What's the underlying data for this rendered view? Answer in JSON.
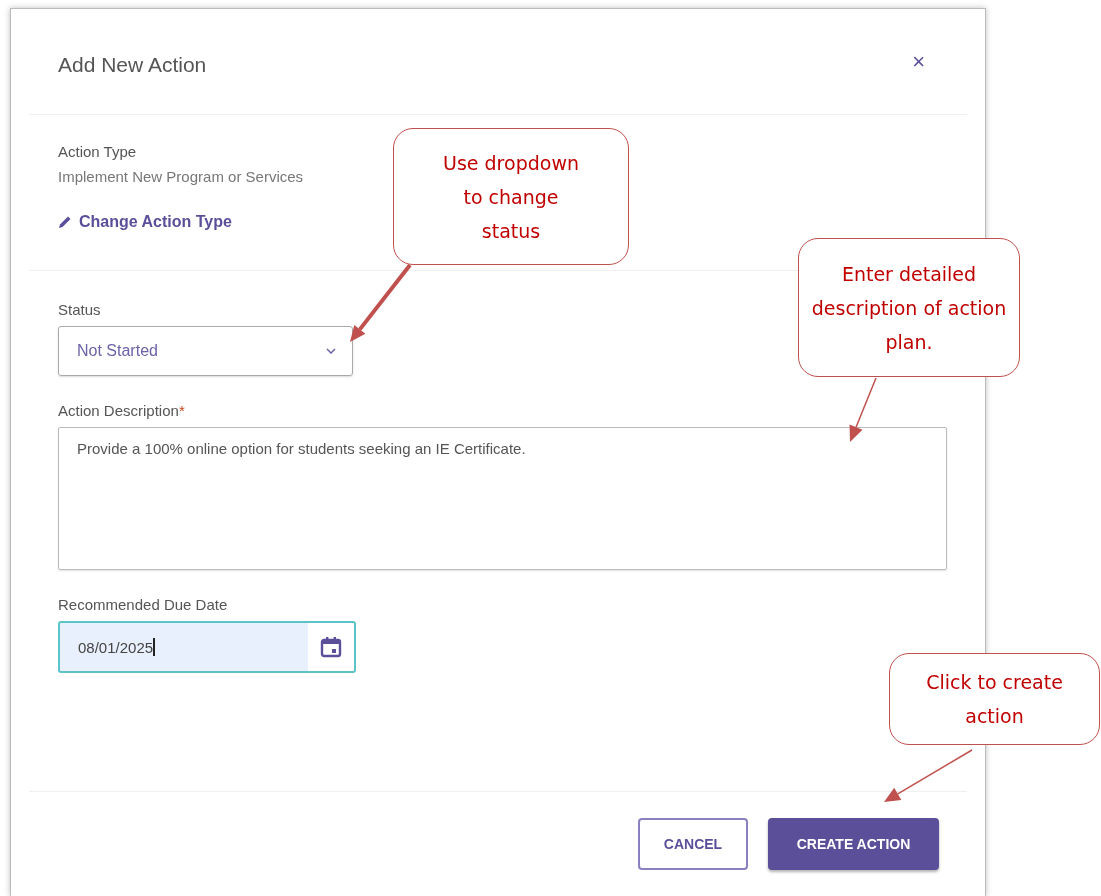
{
  "dialog": {
    "title": "Add New Action",
    "close": "×",
    "action_type": {
      "label": "Action Type",
      "value": "Implement New Program or Services",
      "change_link": "Change Action Type"
    },
    "status": {
      "label": "Status",
      "value": "Not Started"
    },
    "description": {
      "label": "Action Description",
      "required_mark": "*",
      "value": "Provide a 100% online option for students seeking an IE Certificate."
    },
    "due_date": {
      "label": "Recommended Due Date",
      "value": "08/01/2025"
    },
    "buttons": [
      {
        "label": "CANCEL",
        "kind": "secondary"
      },
      {
        "label": "CREATE ACTION",
        "kind": "primary"
      }
    ]
  },
  "callouts": [
    {
      "text": "Use dropdown to change status"
    },
    {
      "text": "Enter detailed description of action plan."
    },
    {
      "text": "Click to create action"
    }
  ]
}
